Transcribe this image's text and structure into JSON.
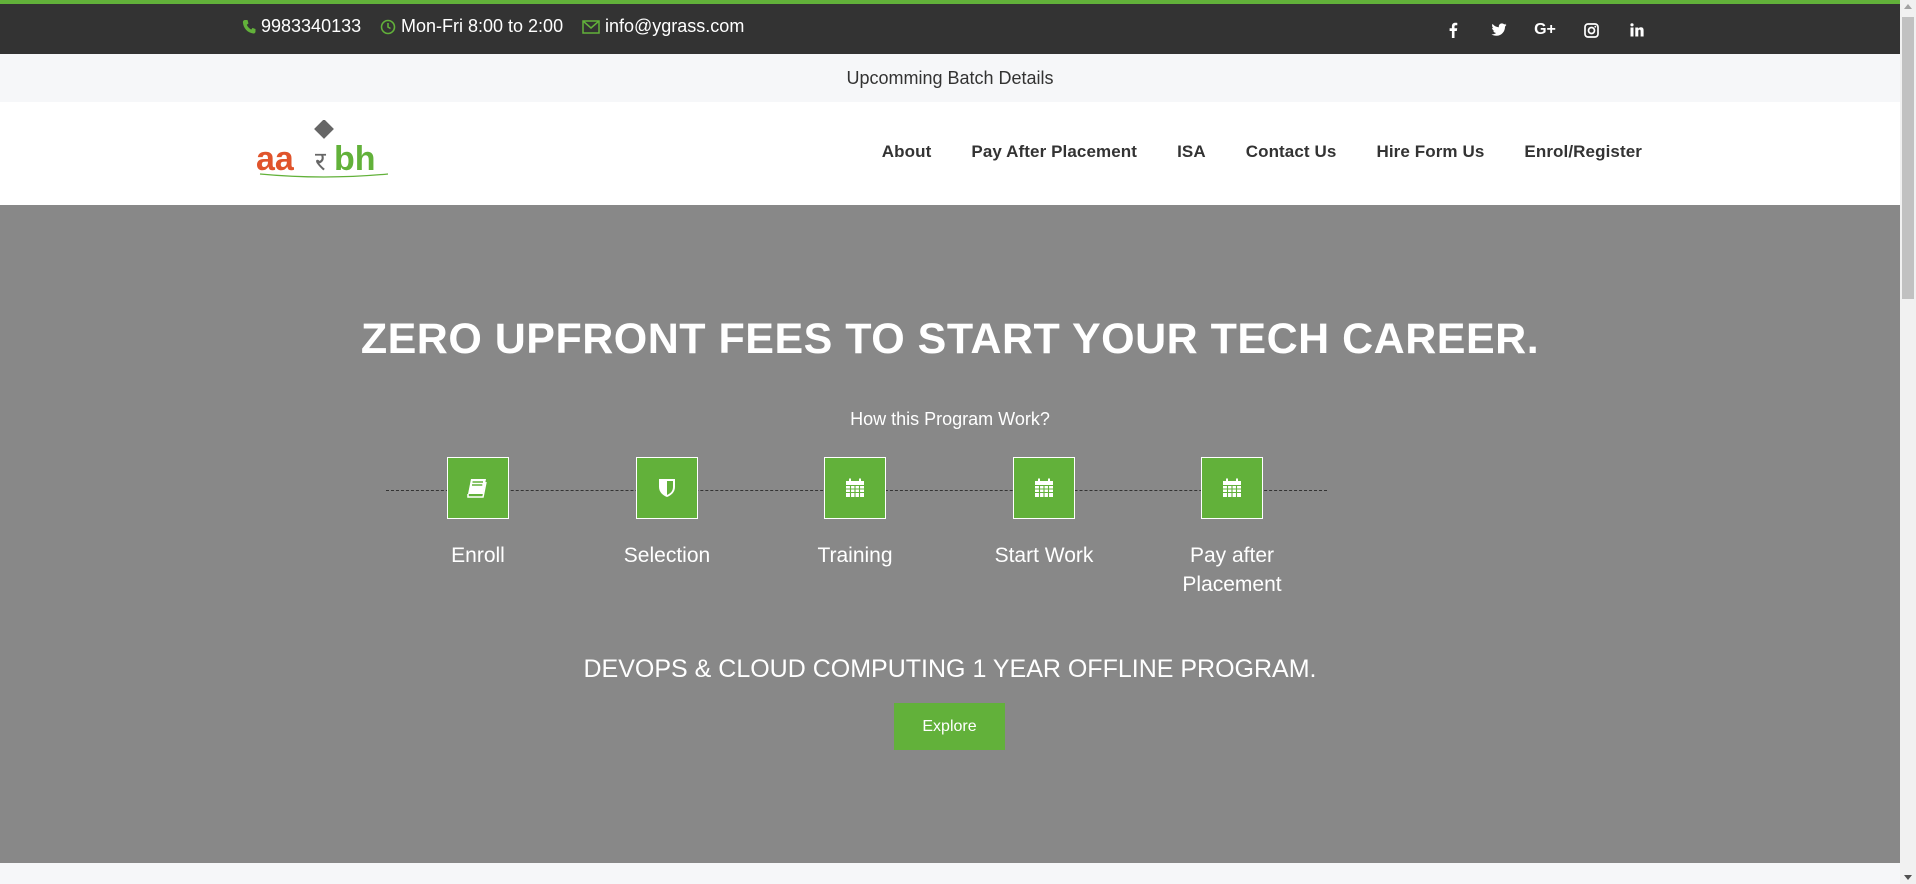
{
  "colors": {
    "accent": "#62b13a",
    "topbar_bg": "#333333",
    "hero_bg": "#888888"
  },
  "topbar": {
    "phone": "9983340133",
    "hours": "Mon-Fri 8:00 to 2:00",
    "email": "info@ygrass.com",
    "social": [
      "facebook-icon",
      "twitter-icon",
      "google-plus-icon",
      "instagram-icon",
      "linkedin-icon"
    ]
  },
  "batch": {
    "label": "Upcomming Batch Details"
  },
  "logo": {
    "text_left": "aa",
    "text_right": "bh",
    "glyph": "र"
  },
  "nav": {
    "items": [
      "About",
      "Pay After Placement",
      "ISA",
      "Contact Us",
      "Hire Form Us",
      "Enrol/Register"
    ]
  },
  "hero": {
    "title": "ZERO UPFRONT FEES TO START YOUR TECH CAREER.",
    "subtitle": "How this Program Work?",
    "steps": [
      {
        "label": "Enroll",
        "icon": "book-icon"
      },
      {
        "label": "Selection",
        "icon": "shield-icon"
      },
      {
        "label": "Training",
        "icon": "calendar-icon"
      },
      {
        "label": "Start Work",
        "icon": "calendar-icon"
      },
      {
        "label": "Pay after Placement",
        "icon": "calendar-icon"
      }
    ],
    "program": "DEVOPS & CLOUD COMPUTING 1 YEAR OFFLINE PROGRAM.",
    "cta": "Explore"
  }
}
